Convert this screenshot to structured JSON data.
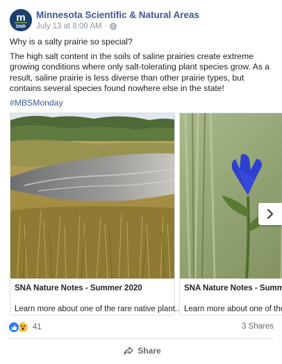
{
  "post": {
    "page_name": "Minnesota Scientific & Natural Areas",
    "logo_text_top": "m",
    "logo_text_bottom": "DNR",
    "date": "July 13 at 8:00 AM",
    "dot": "·",
    "privacy_icon": "globe-icon",
    "paragraphs": [
      "Why is a salty prairie so special?",
      "The high salt content in the soils of saline prairies create extreme growing conditions where only salt-tolerating plant species grow. As a result, saline prairie is less diverse than other prairie types, but contains several species found nowhere else in the state!"
    ],
    "hashtag": "#MBSMonday"
  },
  "carousel": {
    "slides": [
      {
        "title": "SNA Nature Notes - Summer 2020",
        "description": "Learn more about one of the rare native plant..."
      },
      {
        "title": "SNA Nature Notes - Summer",
        "description": "Learn more about one of the r"
      }
    ],
    "next_icon": "chevron-right-icon"
  },
  "engagement": {
    "reaction_icons": [
      "like-icon",
      "wow-icon"
    ],
    "reaction_count": "41",
    "shares": "3 Shares"
  },
  "actions": {
    "share_label": "Share",
    "share_icon": "share-arrow-icon"
  },
  "colors": {
    "link": "#385898",
    "muted": "#606770",
    "like_blue": "#2e7bf4",
    "wow_yellow": "#f7c240"
  }
}
